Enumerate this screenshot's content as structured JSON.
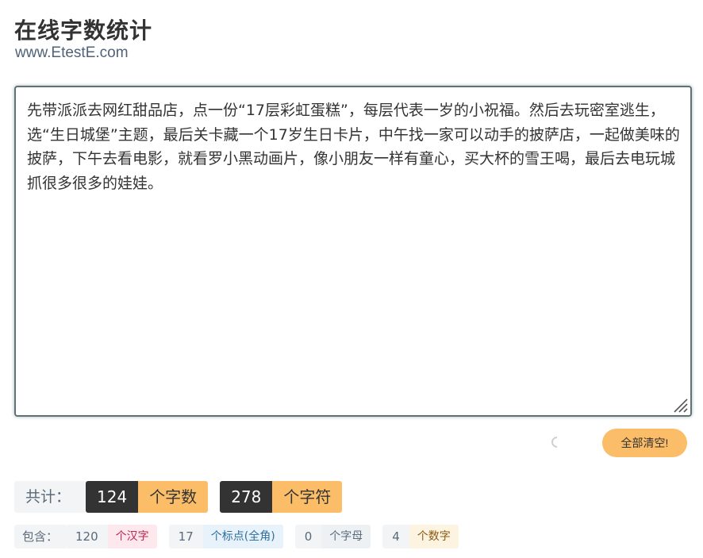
{
  "header": {
    "title": "在线字数统计",
    "site": "www.EtestE.com"
  },
  "editor": {
    "text": "先带派派去网红甜品店，点一份“17层彩虹蛋糕”，每层代表一岁的小祝福。然后去玩密室逃生，选“生日城堡”主题，最后关卡藏一个17岁生日卡片，中午找一家可以动手的披萨店，一起做美味的披萨，下午去看电影，就看罗小黑动画片，像小朋友一样有童心，买大杯的雪王喝，最后去电玩城抓很多很多的娃娃。"
  },
  "actions": {
    "clear_label": "全部清空!"
  },
  "totals": {
    "label": "共计：",
    "words_count": "124",
    "words_unit": "个字数",
    "chars_count": "278",
    "chars_unit": "个字符"
  },
  "details": {
    "label": "包含：",
    "han_count": "120",
    "han_unit": "个汉字",
    "punct_count": "17",
    "punct_unit": "个标点(全角)",
    "alpha_count": "0",
    "alpha_unit": "个字母",
    "digit_count": "4",
    "digit_unit": "个数字"
  },
  "colors": {
    "accent": "#fbbd67",
    "dark": "#333333",
    "editor_border": "#5d7375",
    "han": "#c0254f",
    "punct": "#2f6f9e",
    "digit": "#8a5a12"
  }
}
